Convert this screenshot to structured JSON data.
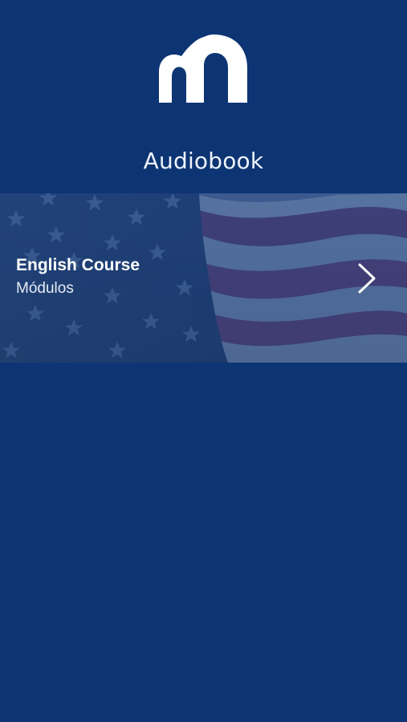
{
  "app": {
    "logo_icon": "brand-m-logo-icon",
    "background_color": "#0d3574"
  },
  "header": {
    "title": "Audiobook"
  },
  "courses": [
    {
      "title": "English Course",
      "subtitle": "Módulos",
      "background": "american-flag-image",
      "action_icon": "chevron-right-icon"
    }
  ]
}
